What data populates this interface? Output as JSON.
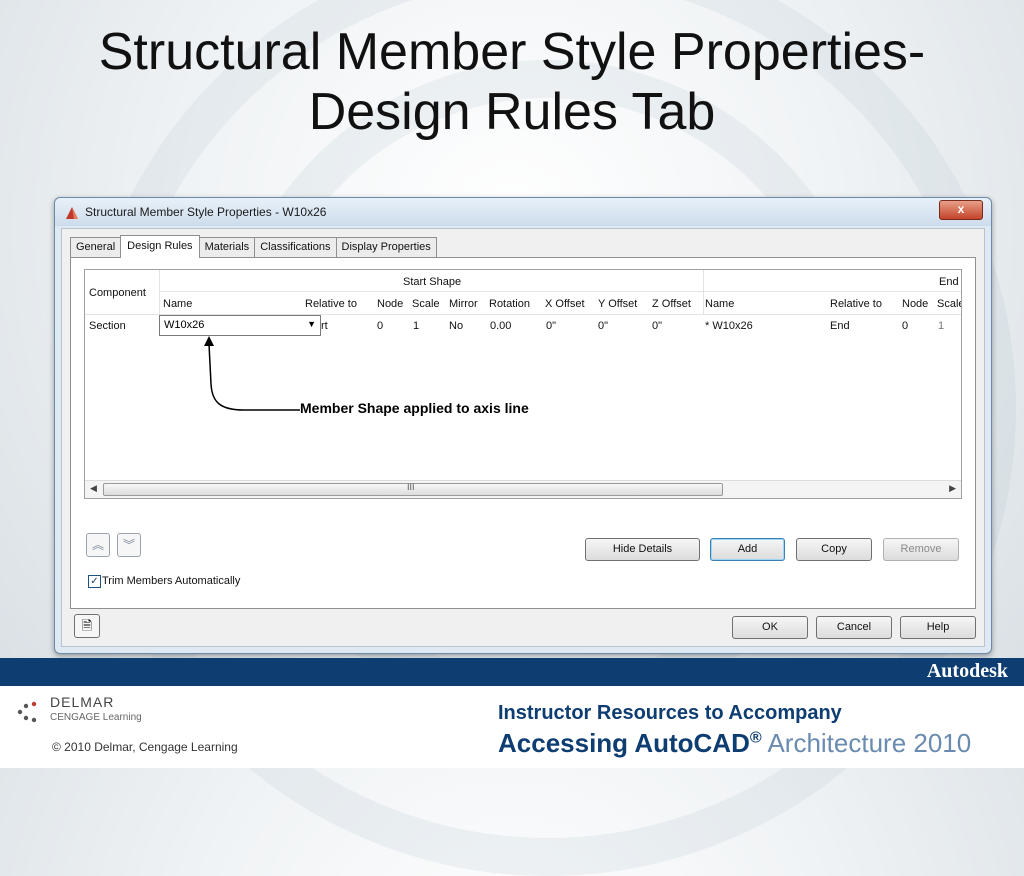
{
  "slide": {
    "title_line1": "Structural Member Style Properties-",
    "title_line2": "Design Rules Tab",
    "callout": "Member Shape applied to axis line"
  },
  "window": {
    "title": "Structural Member Style Properties - W10x26",
    "close_label": "x",
    "tabs": [
      {
        "label": "General",
        "active": false
      },
      {
        "label": "Design Rules",
        "active": true
      },
      {
        "label": "Materials",
        "active": false
      },
      {
        "label": "Classifications",
        "active": false
      },
      {
        "label": "Display Properties",
        "active": false
      }
    ]
  },
  "grid": {
    "component_header": "Component",
    "start_group": "Start Shape",
    "end_group": "End",
    "columns": [
      "Name",
      "Relative to",
      "Node",
      "Scale",
      "Mirror",
      "Rotation",
      "X Offset",
      "Y Offset",
      "Z Offset",
      "Name",
      "Relative to",
      "Node",
      "Scale"
    ],
    "row": {
      "component": "Section",
      "start_name": "W10x26",
      "start_relative": "rt",
      "start_node": "0",
      "start_scale": "1",
      "start_mirror": "No",
      "start_rotation": "0.00",
      "start_x": "0\"",
      "start_y": "0\"",
      "start_z": "0\"",
      "end_name": "* W10x26",
      "end_relative": "End",
      "end_node": "0",
      "end_scale": "1"
    },
    "scroll_grip": "III"
  },
  "buttons": {
    "hide_details": "Hide Details",
    "add": "Add",
    "copy": "Copy",
    "remove": "Remove",
    "ok": "OK",
    "cancel": "Cancel",
    "help": "Help"
  },
  "checkbox": {
    "label": "Trim Members Automatically",
    "checked": true
  },
  "footer": {
    "brand": "Autodesk",
    "publisher": "DELMAR",
    "publisher_sub": "CENGAGE Learning",
    "copyright": "© 2010 Delmar, Cengage Learning",
    "line1": "Instructor Resources to Accompany",
    "line2_bold": "Accessing AutoCAD",
    "line2_reg": "®",
    "line2_lite": " Architecture 2010"
  },
  "colors": {
    "footer_blue": "#0e3d72",
    "accent_light": "#6a8bb0"
  }
}
